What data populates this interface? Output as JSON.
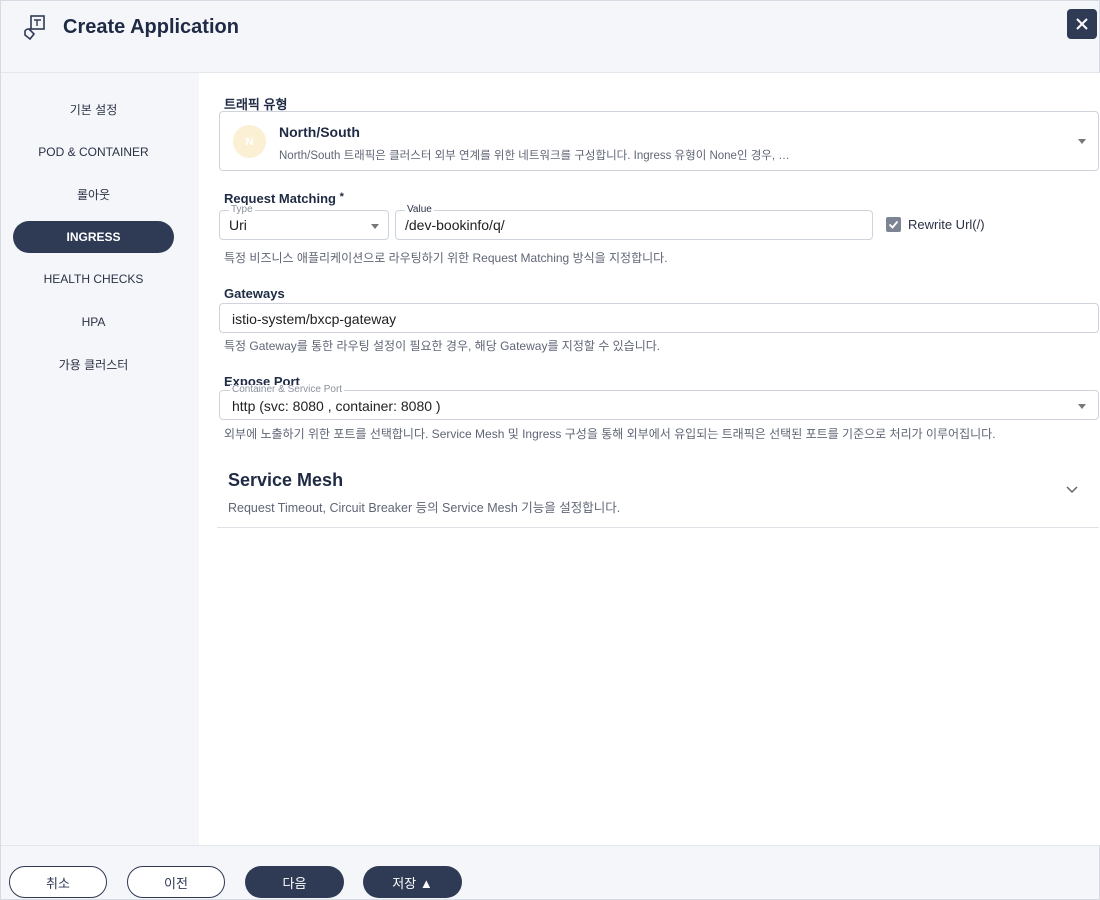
{
  "header": {
    "title": "Create Application",
    "app_icon": "puzzle-icon",
    "close_icon": "close-icon"
  },
  "sidebar": {
    "items": [
      {
        "label": "기본 설정",
        "active": false
      },
      {
        "label": "POD & CONTAINER",
        "active": false
      },
      {
        "label": "롤아웃",
        "active": false
      },
      {
        "label": "INGRESS",
        "active": true
      },
      {
        "label": "HEALTH CHECKS",
        "active": false
      },
      {
        "label": "HPA",
        "active": false
      },
      {
        "label": "가용 클러스터",
        "active": false
      }
    ]
  },
  "traffic": {
    "label": "트래픽 유형",
    "avatar": "N",
    "name": "North/South",
    "description": "North/South 트래픽은 클러스터 외부 연계를 위한 네트워크를 구성합니다. Ingress 유형이 None인 경우, …"
  },
  "request_matching": {
    "label": "Request Matching",
    "required_mark": "*",
    "type_legend": "Type",
    "type_value": "Uri",
    "value_legend": "Value",
    "value": "/dev-bookinfo/q/",
    "rewrite_label": "Rewrite Url(/)",
    "rewrite_checked": true,
    "helper": "특정 비즈니스 애플리케이션으로 라우팅하기 위한 Request Matching 방식을 지정합니다."
  },
  "gateways": {
    "label": "Gateways",
    "value": "istio-system/bxcp-gateway",
    "helper": "특정 Gateway를 통한 라우팅 설정이 필요한 경우, 해당 Gateway를 지정할 수 있습니다."
  },
  "expose_port": {
    "label": "Expose Port",
    "legend": "Container & Service Port",
    "value": "http (svc: 8080 , container: 8080 )",
    "helper": "외부에 노출하기 위한 포트를 선택합니다. Service Mesh 및 Ingress 구성을 통해 외부에서 유입되는 트래픽은 선택된 포트를 기준으로 처리가 이루어집니다."
  },
  "service_mesh": {
    "title": "Service Mesh",
    "description": "Request Timeout, Circuit Breaker 등의 Service Mesh 기능을 설정합니다.",
    "expand_icon": "chevron-down-icon"
  },
  "footer": {
    "cancel": "취소",
    "prev": "이전",
    "next": "다음",
    "save": "저장 ▲"
  },
  "colors": {
    "primary": "#2f3a55",
    "sidebar_bg": "#f4f6f9",
    "avatar_bg": "#fbefd4"
  }
}
